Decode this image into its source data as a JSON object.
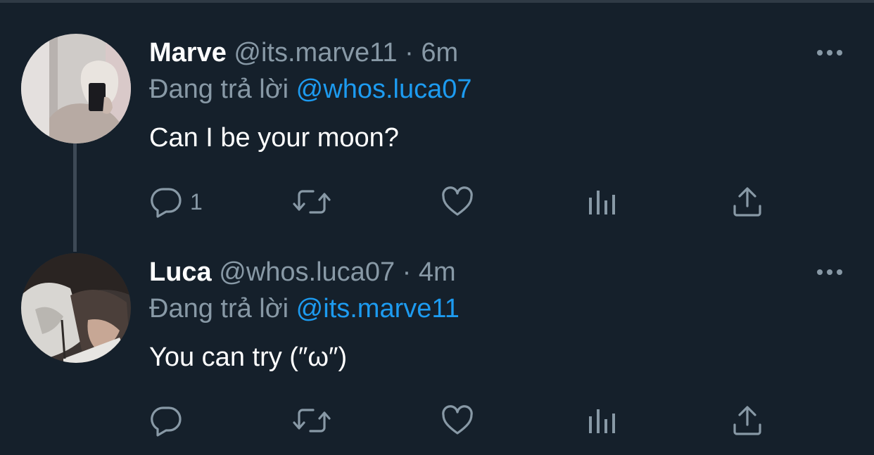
{
  "tweets": [
    {
      "name": "Marve",
      "handle": "@its.marve11",
      "separator": "·",
      "time": "6m",
      "replying_label": "Đang trả lời",
      "replying_to": "@whos.luca07",
      "text": "Can I be your moon?",
      "reply_count": "1",
      "avatar_icon": "avatar-photo"
    },
    {
      "name": "Luca",
      "handle": "@whos.luca07",
      "separator": "·",
      "time": "4m",
      "replying_label": "Đang trả lời",
      "replying_to": "@its.marve11",
      "text": "You can try (″ω″)",
      "reply_count": "",
      "avatar_icon": "avatar-photo"
    }
  ],
  "icons": {
    "reply": "reply-icon",
    "retweet": "retweet-icon",
    "like": "heart-icon",
    "views": "analytics-icon",
    "share": "share-icon",
    "more": "more-icon"
  },
  "colors": {
    "background": "#15202b",
    "primary_text": "#ffffff",
    "secondary_text": "#8899a6",
    "mention": "#1d9bf0"
  }
}
